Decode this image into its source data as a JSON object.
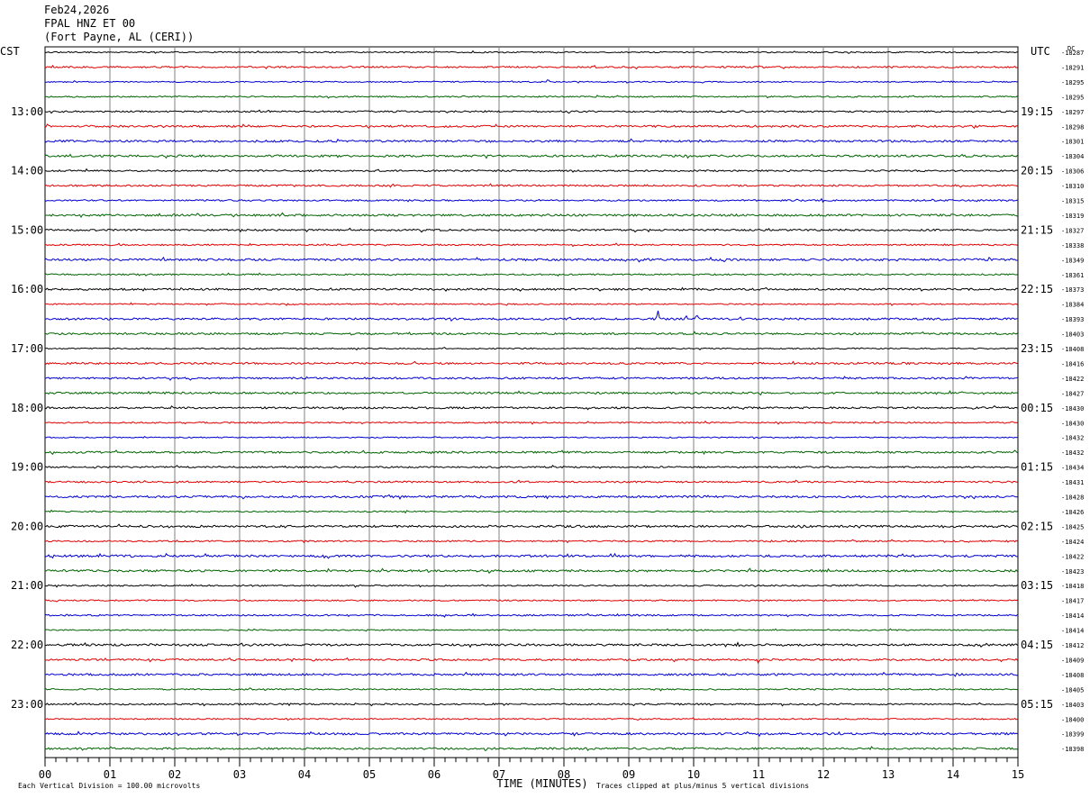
{
  "header": {
    "date": "Feb24,2026",
    "station": "FPAL HNZ ET 00",
    "location": "(Fort Payne, AL (CERI))"
  },
  "chart_data": {
    "type": "line",
    "plot_kind": "helicorder",
    "left_axis_label": "CST",
    "right_axis_label": "UTC",
    "dc_label": "DC",
    "xlabel": "TIME (MINUTES)",
    "x_ticks": [
      "00",
      "01",
      "02",
      "03",
      "04",
      "05",
      "06",
      "07",
      "08",
      "09",
      "10",
      "11",
      "12",
      "13",
      "14",
      "15"
    ],
    "xlim": [
      0,
      15
    ],
    "left_hour_labels": [
      "13:00",
      "14:00",
      "15:00",
      "16:00",
      "17:00",
      "18:00",
      "19:00",
      "20:00",
      "21:00",
      "22:00",
      "23:00"
    ],
    "right_hour_labels": [
      "19:15",
      "20:15",
      "21:15",
      "22:15",
      "23:15",
      "00:15",
      "01:15",
      "02:15",
      "03:15",
      "04:15",
      "05:15"
    ],
    "dc_offsets": [
      "-18287",
      "-18291",
      "-18295",
      "-18295",
      "-18297",
      "-18298",
      "-18301",
      "-18304",
      "-18306",
      "-18310",
      "-18315",
      "-18319",
      "-18327",
      "-18338",
      "-18349",
      "-18361",
      "-18373",
      "-18384",
      "-18393",
      "-18403",
      "-18408",
      "-18416",
      "-18422",
      "-18427",
      "-18430",
      "-18430",
      "-18432",
      "-18432",
      "-18434",
      "-18431",
      "-18428",
      "-18426",
      "-18425",
      "-18424",
      "-18422",
      "-18423",
      "-18418",
      "-18417",
      "-18414",
      "-18414",
      "-18412",
      "-18409",
      "-18408",
      "-18405",
      "-18403",
      "-18400",
      "-18399",
      "-18398"
    ],
    "trace_colors": [
      "#000000",
      "#e00000",
      "#0000d0",
      "#006400"
    ],
    "grid_color": "#808080",
    "footer_left": "Each Vertical Division =  100.00 microvolts",
    "footer_right": "Traces clipped at plus/minus 5 vertical divisions",
    "events": [
      {
        "trace": 18,
        "minute": 9.45,
        "amplitude": -10
      },
      {
        "trace": 18,
        "minute": 9.88,
        "amplitude": -4
      },
      {
        "trace": 18,
        "minute": 10.05,
        "amplitude": -4
      },
      {
        "trace": 41,
        "minute": 11.0,
        "amplitude": 4
      },
      {
        "trace": 2,
        "minute": 7.75,
        "amplitude": -3
      }
    ]
  }
}
